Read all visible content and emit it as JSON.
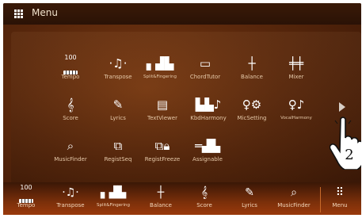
{
  "header": {
    "title": "Menu",
    "icon": "grid-icon"
  },
  "menu": {
    "rows": [
      [
        {
          "label": "Tempo",
          "icon": "tempo-icon",
          "value": "100"
        },
        {
          "label": "Transpose",
          "icon": "transpose-icon"
        },
        {
          "label": "Split&Fingering",
          "icon": "split-fingering-icon"
        },
        {
          "label": "ChordTutor",
          "icon": "chord-tutor-icon"
        },
        {
          "label": "Balance",
          "icon": "balance-icon"
        },
        {
          "label": "Mixer",
          "icon": "mixer-icon"
        }
      ],
      [
        {
          "label": "Score",
          "icon": "score-icon"
        },
        {
          "label": "Lyrics",
          "icon": "lyrics-icon"
        },
        {
          "label": "TextViewer",
          "icon": "text-viewer-icon"
        },
        {
          "label": "KbdHarmony",
          "icon": "kbd-harmony-icon"
        },
        {
          "label": "MicSetting",
          "icon": "mic-setting-icon"
        },
        {
          "label": "VocalHarmony",
          "icon": "vocal-harmony-icon"
        }
      ],
      [
        {
          "label": "MusicFinder",
          "icon": "music-finder-icon"
        },
        {
          "label": "RegistSeq",
          "icon": "regist-seq-icon"
        },
        {
          "label": "RegistFreeze",
          "icon": "regist-freeze-icon"
        },
        {
          "label": "Assignable",
          "icon": "assignable-icon"
        }
      ]
    ],
    "next_page_icon": "chevron-right-icon"
  },
  "annotation": {
    "step": "2",
    "icon": "pointing-hand-icon"
  },
  "bottom_bar": {
    "items": [
      {
        "label": "Tempo",
        "icon": "tempo-icon",
        "value": "100"
      },
      {
        "label": "Transpose",
        "icon": "transpose-icon"
      },
      {
        "label": "Split&Fingering",
        "icon": "split-fingering-icon"
      },
      {
        "label": "Balance",
        "icon": "balance-icon"
      },
      {
        "label": "Score",
        "icon": "score-icon"
      },
      {
        "label": "Lyrics",
        "icon": "lyrics-icon"
      },
      {
        "label": "MusicFinder",
        "icon": "music-finder-icon"
      },
      {
        "label": "Menu",
        "icon": "menu-grid-icon"
      }
    ]
  },
  "colors": {
    "background": "#5a280c",
    "titlebar": "#2a1206",
    "bottom_bar": "#7a2f0a",
    "label": "#e6c9a9"
  }
}
